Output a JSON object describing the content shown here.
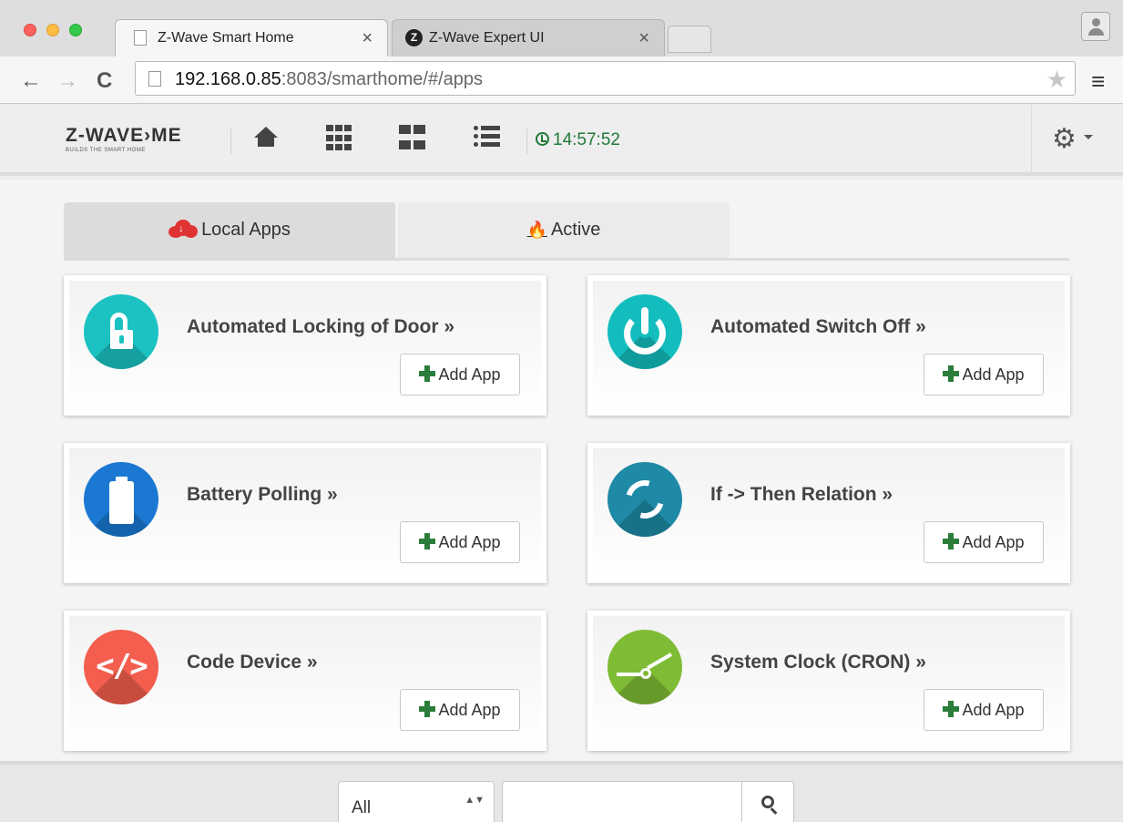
{
  "browser": {
    "tabs": [
      {
        "label": "Z-Wave Smart Home",
        "close": "×"
      },
      {
        "label": "Z-Wave Expert UI",
        "close": "×",
        "favicon": "Z"
      }
    ],
    "url_host": "192.168.0.85",
    "url_rest": ":8083/smarthome/#/apps",
    "icons": {
      "back": "←",
      "forward": "→",
      "reload": "C",
      "star": "★",
      "menu": "≡"
    }
  },
  "navbar": {
    "logo": "Z-WAVE›ME",
    "logo_sub": "BUILDS THE SMART HOME",
    "time": "14:57:52",
    "gear": "⚙"
  },
  "tabs": {
    "local": "Local Apps",
    "active": "Active"
  },
  "apps": [
    {
      "title": "Automated Locking of Door »",
      "button": "Add App",
      "icon": "lock-icon",
      "color": "#1cc2c2"
    },
    {
      "title": "Automated Switch Off »",
      "button": "Add App",
      "icon": "power-icon",
      "color": "#13bdbd"
    },
    {
      "title": "Battery Polling »",
      "button": "Add App",
      "icon": "battery-icon",
      "color": "#1a78d2"
    },
    {
      "title": "If -> Then Relation »",
      "button": "Add App",
      "icon": "sync-icon",
      "color": "#1f8aa6"
    },
    {
      "title": "Code Device »",
      "button": "Add App",
      "icon": "code-icon",
      "color": "#f35e4e"
    },
    {
      "title": "System Clock (CRON) »",
      "button": "Add App",
      "icon": "clock-icon",
      "color": "#7fbc35"
    }
  ],
  "apps_code_glyph": "</>",
  "footer": {
    "filter_value": "All",
    "select_arrows": "▲▼",
    "search_placeholder": ""
  }
}
